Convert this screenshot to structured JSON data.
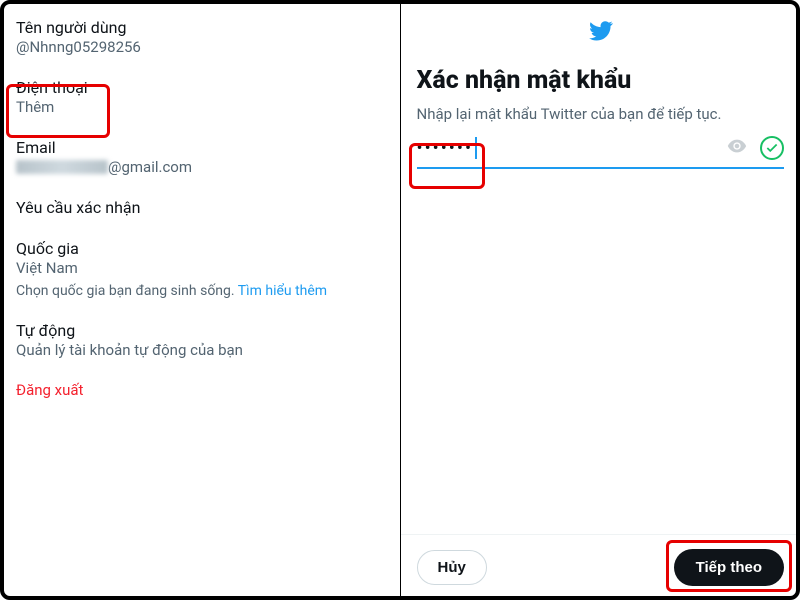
{
  "left": {
    "username_label": "Tên người dùng",
    "username_value": "@Nhnng05298256",
    "phone_label": "Điện thoại",
    "phone_value": "Thêm",
    "email_label": "Email",
    "email_domain": "@gmail.com",
    "verify_label": "Yêu cầu xác nhận",
    "country_label": "Quốc gia",
    "country_value": "Việt Nam",
    "country_hint": "Chọn quốc gia bạn đang sinh sống.",
    "country_link": "Tìm hiểu thêm",
    "auto_label": "Tự động",
    "auto_hint": "Quản lý tài khoản tự động của bạn",
    "signout": "Đăng xuất"
  },
  "right": {
    "title": "Xác nhận mật khẩu",
    "subtitle": "Nhập lại mật khẩu Twitter của bạn để tiếp tục.",
    "password_mask": "•••••••",
    "cancel": "Hủy",
    "next": "Tiếp theo"
  }
}
